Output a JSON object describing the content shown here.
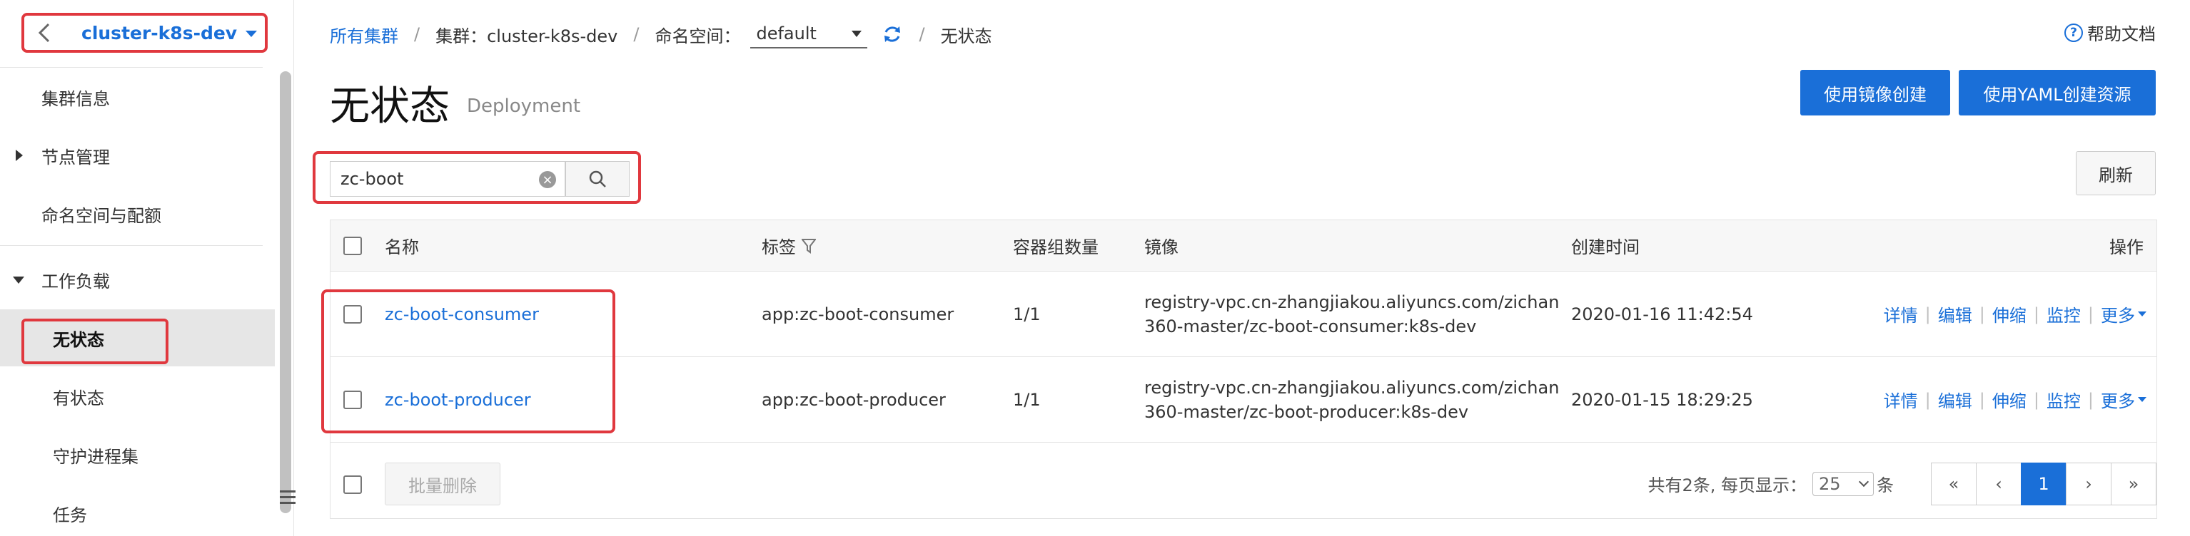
{
  "sidebar": {
    "cluster_name": "cluster-k8s-dev",
    "items": [
      {
        "label": "集群信息"
      },
      {
        "label": "节点管理"
      },
      {
        "label": "命名空间与配额"
      },
      {
        "label": "工作负载"
      },
      {
        "label": "无状态"
      },
      {
        "label": "有状态"
      },
      {
        "label": "守护进程集"
      },
      {
        "label": "任务"
      }
    ]
  },
  "breadcrumb": {
    "all_clusters": "所有集群",
    "cluster_label": "集群：cluster-k8s-dev",
    "namespace_label": "命名空间：",
    "namespace_value": "default",
    "current": "无状态"
  },
  "help": {
    "label": "帮助文档"
  },
  "page": {
    "title": "无状态",
    "subtitle": "Deployment"
  },
  "actions": {
    "create_by_image": "使用镜像创建",
    "create_by_yaml": "使用YAML创建资源",
    "refresh": "刷新"
  },
  "search": {
    "value": "zc-boot"
  },
  "table": {
    "headers": {
      "name": "名称",
      "labels": "标签",
      "pods": "容器组数量",
      "image": "镜像",
      "created": "创建时间",
      "ops": "操作"
    },
    "rows": [
      {
        "name": "zc-boot-consumer",
        "label": "app:zc-boot-consumer",
        "pods": "1/1",
        "image_line1": "registry-vpc.cn-zhangjiakou.aliyuncs.com/zichan",
        "image_line2": "360-master/zc-boot-consumer:k8s-dev",
        "created": "2020-01-16 11:42:54"
      },
      {
        "name": "zc-boot-producer",
        "label": "app:zc-boot-producer",
        "pods": "1/1",
        "image_line1": "registry-vpc.cn-zhangjiakou.aliyuncs.com/zichan",
        "image_line2": "360-master/zc-boot-producer:k8s-dev",
        "created": "2020-01-15 18:29:25"
      }
    ],
    "ops": {
      "detail": "详情",
      "edit": "编辑",
      "scale": "伸缩",
      "monitor": "监控",
      "more": "更多"
    }
  },
  "footer": {
    "bulk_delete": "批量删除",
    "total_text": "共有2条, 每页显示：",
    "page_size": "25",
    "unit": "条",
    "pager": {
      "first": "«",
      "prev": "‹",
      "current": "1",
      "next": "›",
      "last": "»"
    }
  },
  "colors": {
    "accent": "#1a6fd8",
    "highlight": "#e0383e"
  }
}
